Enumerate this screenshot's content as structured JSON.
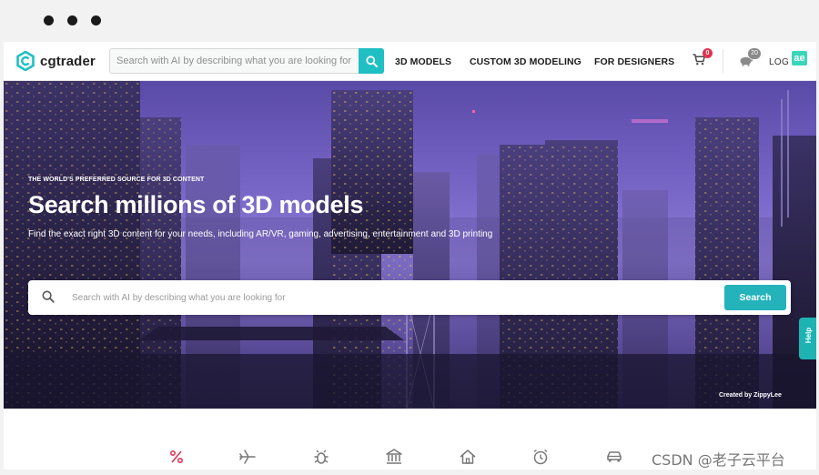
{
  "window": {
    "controls": [
      "close",
      "minimize",
      "maximize"
    ]
  },
  "nav": {
    "logo_text": "cgtrader",
    "search_placeholder": "Search with AI by describing what you are looking for",
    "links": [
      "3D MODELS",
      "CUSTOM 3D MODELING",
      "FOR DESIGNERS"
    ],
    "cart_count": "0",
    "savings_count": "20",
    "login_label": "LOG I",
    "ae_label": "ae"
  },
  "hero": {
    "eyebrow": "THE WORLD'S PREFERRED SOURCE FOR 3D CONTENT",
    "title": "Search millions of 3D models",
    "subtitle": "Find the exact right 3D content for your needs, including AR/VR, gaming, advertising, entertainment and 3D printing",
    "search_placeholder": "Search with AI by describing what you are looking for",
    "search_button": "Search",
    "credit": "Created by ZippyLee"
  },
  "help_tab": "Help",
  "categories": [
    "percent-icon",
    "airplane-icon",
    "bug-icon",
    "museum-icon",
    "house-icon",
    "alarm-clock-icon",
    "car-icon"
  ],
  "watermark": "CSDN @老子云平台",
  "colors": {
    "accent": "#1fbfc4",
    "badge": "#e2334e",
    "discount": "#e0345a"
  }
}
